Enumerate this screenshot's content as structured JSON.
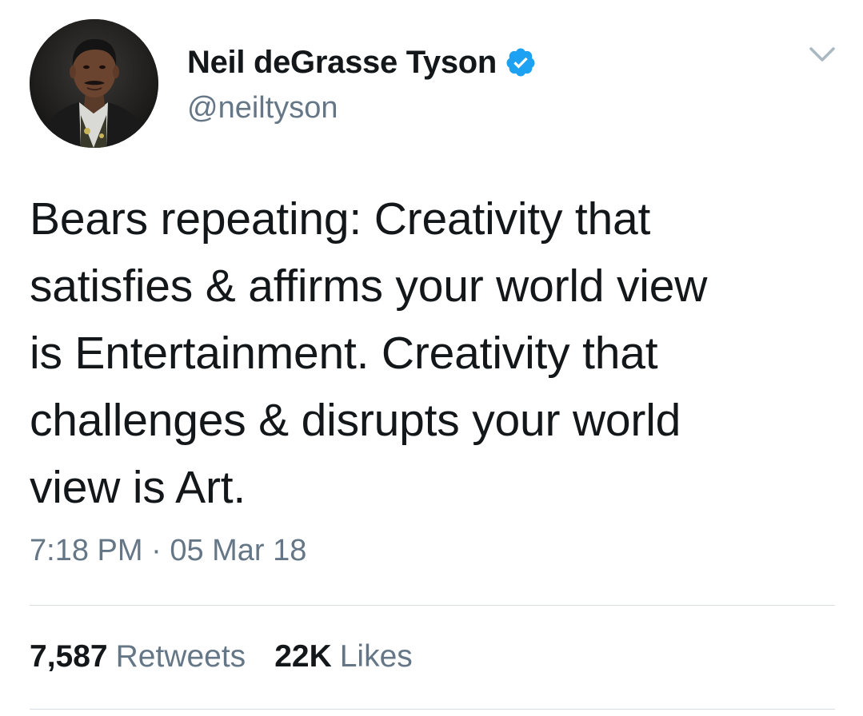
{
  "tweet": {
    "author": {
      "display_name": "Neil deGrasse Tyson",
      "handle": "@neiltyson",
      "verified": true,
      "avatar_icon": "profile-photo"
    },
    "text_lines": [
      "Bears repeating: Creativity that",
      "satisfies & affirms your world view",
      "is Entertainment. Creativity that",
      "challenges & disrupts your world",
      "view is Art."
    ],
    "time": "7:18 PM",
    "separator": "·",
    "date": "05 Mar 18",
    "stats": {
      "retweets_count": "7,587",
      "retweets_label": "Retweets",
      "likes_count": "22K",
      "likes_label": "Likes"
    },
    "menu_icon": "chevron-down-icon"
  },
  "colors": {
    "text": "#14171a",
    "secondary": "#657786",
    "verified_badge": "#1da1f2",
    "divider": "#d8dee3"
  }
}
